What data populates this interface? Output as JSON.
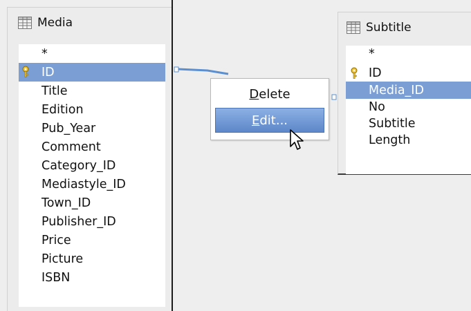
{
  "media_table": {
    "title": "Media",
    "fields": [
      "*",
      "ID",
      "Title",
      "Edition",
      "Pub_Year",
      "Comment",
      "Category_ID",
      "Mediastyle_ID",
      "Town_ID",
      "Publisher_ID",
      "Price",
      "Picture",
      "ISBN"
    ],
    "primary_key": "ID",
    "selected_field": "ID"
  },
  "subtitle_table": {
    "title": "Subtitle",
    "fields": [
      "*",
      "ID",
      "Media_ID",
      "No",
      "Subtitle",
      "Length"
    ],
    "primary_key": "ID",
    "selected_field": "Media_ID"
  },
  "context_menu": {
    "delete_mnemonic": "D",
    "delete_rest": "elete",
    "edit_mnemonic": "E",
    "edit_rest": "dit...",
    "highlighted_item": "Edit..."
  },
  "colors": {
    "selection": "#7b9fd4",
    "relation_line": "#5b8fd0",
    "menu_highlight": "#6b93d2"
  }
}
